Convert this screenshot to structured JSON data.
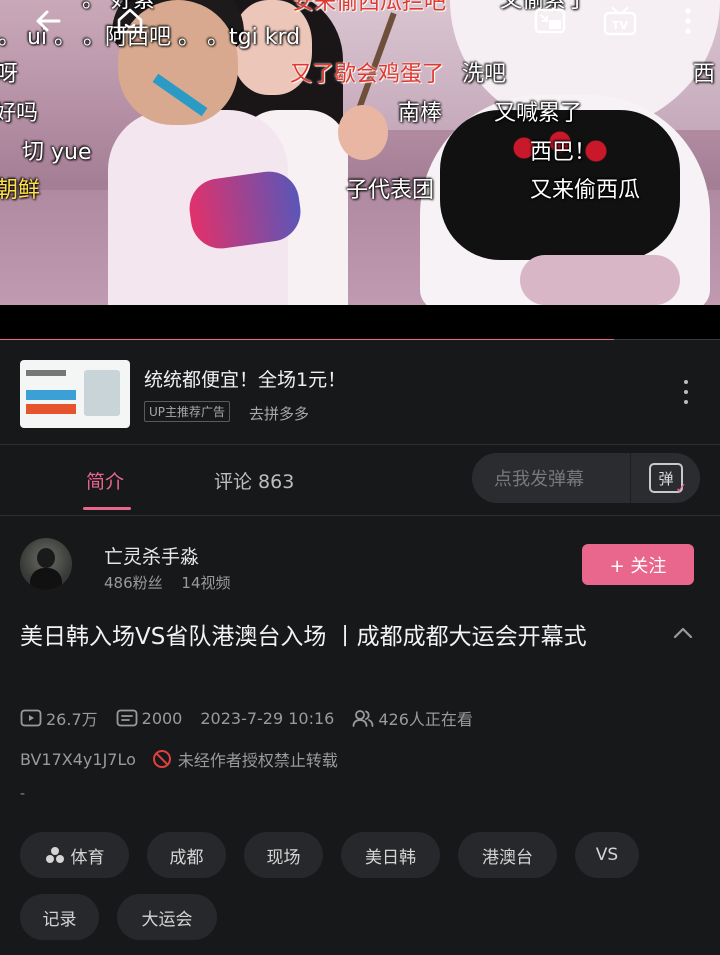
{
  "player": {
    "progress": 0.853,
    "danmaku": [
      {
        "text": "。 好累",
        "color": "white"
      },
      {
        "text": "安来偷西瓜拦吧",
        "color": "red"
      },
      {
        "text": "又偷累了",
        "color": "white"
      },
      {
        "text": "。 ui 。 。阿西吧 。 。tgi krd",
        "color": "white"
      },
      {
        "text": "呀",
        "color": "white"
      },
      {
        "text": "又了歇会鸡蛋了",
        "color": "red"
      },
      {
        "text": "洗吧",
        "color": "white"
      },
      {
        "text": "西",
        "color": "white"
      },
      {
        "text": "好吗",
        "color": "white"
      },
      {
        "text": "南棒",
        "color": "white"
      },
      {
        "text": "又喊累了",
        "color": "white"
      },
      {
        "text": "切 yue",
        "color": "white"
      },
      {
        "text": "西巴！",
        "color": "white"
      },
      {
        "text": "朝鲜",
        "color": "yellow"
      },
      {
        "text": "子代表团",
        "color": "white"
      },
      {
        "text": "又来偷西瓜",
        "color": "white"
      }
    ]
  },
  "ad": {
    "title": "统统都便宜！全场1元！",
    "tag": "UP主推荐广告",
    "subtitle": "去拼多多"
  },
  "tabs": {
    "intro": "简介",
    "comments": "评论 863",
    "danmaku_placeholder": "点我发弹幕",
    "danmaku_button": "弹"
  },
  "uploader": {
    "name": "亡灵杀手淼",
    "fans": "486粉丝",
    "videos": "14视频",
    "follow_label": "+ 关注"
  },
  "video": {
    "title": "美日韩入场VS省队港澳台入场 丨成都成都大运会开幕式",
    "views": "26.7万",
    "danmaku_count": "2000",
    "date": "2023-7-29 10:16",
    "watching": "426人正在看",
    "bvid": "BV17X4y1J7Lo",
    "copyright": "未经作者授权禁止转载",
    "desc": "-"
  },
  "tags": [
    "体育",
    "成都",
    "现场",
    "美日韩",
    "港澳台",
    "VS",
    "记录",
    "大运会"
  ],
  "colors": {
    "accent": "#e9668d",
    "background": "#17181a",
    "chip": "#27282b",
    "forbid": "#e0413f"
  }
}
